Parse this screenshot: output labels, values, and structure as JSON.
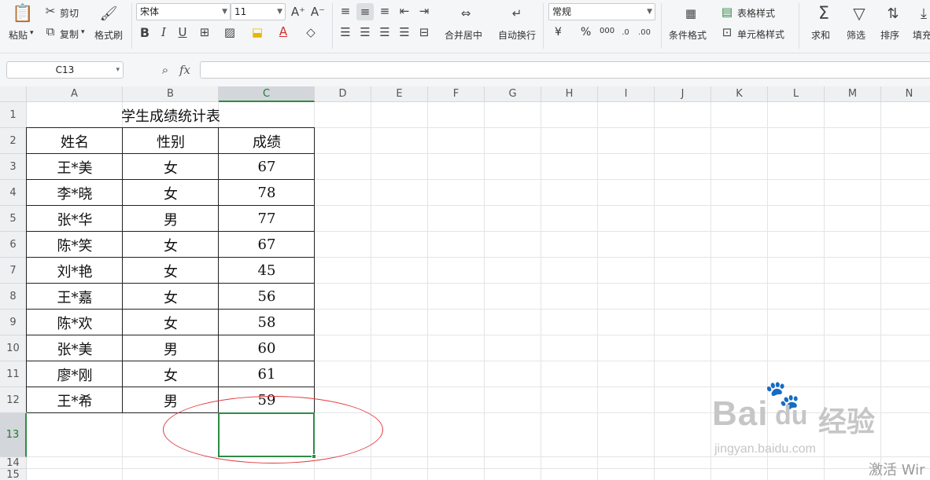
{
  "ribbon": {
    "paste": "粘贴",
    "cut": "剪切",
    "copy": "复制",
    "format_painter": "格式刷",
    "font_name": "宋体",
    "font_size": "11",
    "merge_center": "合并居中",
    "wrap_text": "自动换行",
    "number_format": "常规",
    "currency_symbol": "¥",
    "percent_symbol": "%",
    "thousands_symbol": "000",
    "conditional_format": "条件格式",
    "table_style": "表格样式",
    "cell_style": "单元格样式",
    "sum": "求和",
    "filter": "筛选",
    "sort": "排序",
    "fill": "填充"
  },
  "formula_bar": {
    "name_box": "C13",
    "fx": "fx",
    "value": ""
  },
  "sheet": {
    "columns": [
      "A",
      "B",
      "C",
      "D",
      "E",
      "F",
      "G",
      "H",
      "I",
      "J",
      "K",
      "L",
      "M",
      "N"
    ],
    "rows": [
      "1",
      "2",
      "3",
      "4",
      "5",
      "6",
      "7",
      "8",
      "9",
      "10",
      "11",
      "12",
      "13",
      "14",
      "15"
    ],
    "selected_cell": "C13",
    "title": "学生成绩统计表",
    "headers": [
      "姓名",
      "性别",
      "成绩"
    ],
    "records": [
      {
        "name": "王*美",
        "gender": "女",
        "score": "67"
      },
      {
        "name": "李*晓",
        "gender": "女",
        "score": "78"
      },
      {
        "name": "张*华",
        "gender": "男",
        "score": "77"
      },
      {
        "name": "陈*笑",
        "gender": "女",
        "score": "67"
      },
      {
        "name": "刘*艳",
        "gender": "女",
        "score": "45"
      },
      {
        "name": "王*嘉",
        "gender": "女",
        "score": "56"
      },
      {
        "name": "陈*欢",
        "gender": "女",
        "score": "58"
      },
      {
        "name": "张*美",
        "gender": "男",
        "score": "60"
      },
      {
        "name": "廖*刚",
        "gender": "女",
        "score": "61"
      },
      {
        "name": "王*希",
        "gender": "男",
        "score": "59"
      }
    ]
  },
  "watermark": {
    "brand_latin": "Bai",
    "brand_suffix": "du",
    "brand_cn": "经验",
    "url": "jingyan.baidu.com",
    "activate": "激活 Wir"
  },
  "colors": {
    "selection": "#2e8b45",
    "annotation_oval": "#e0393e"
  }
}
